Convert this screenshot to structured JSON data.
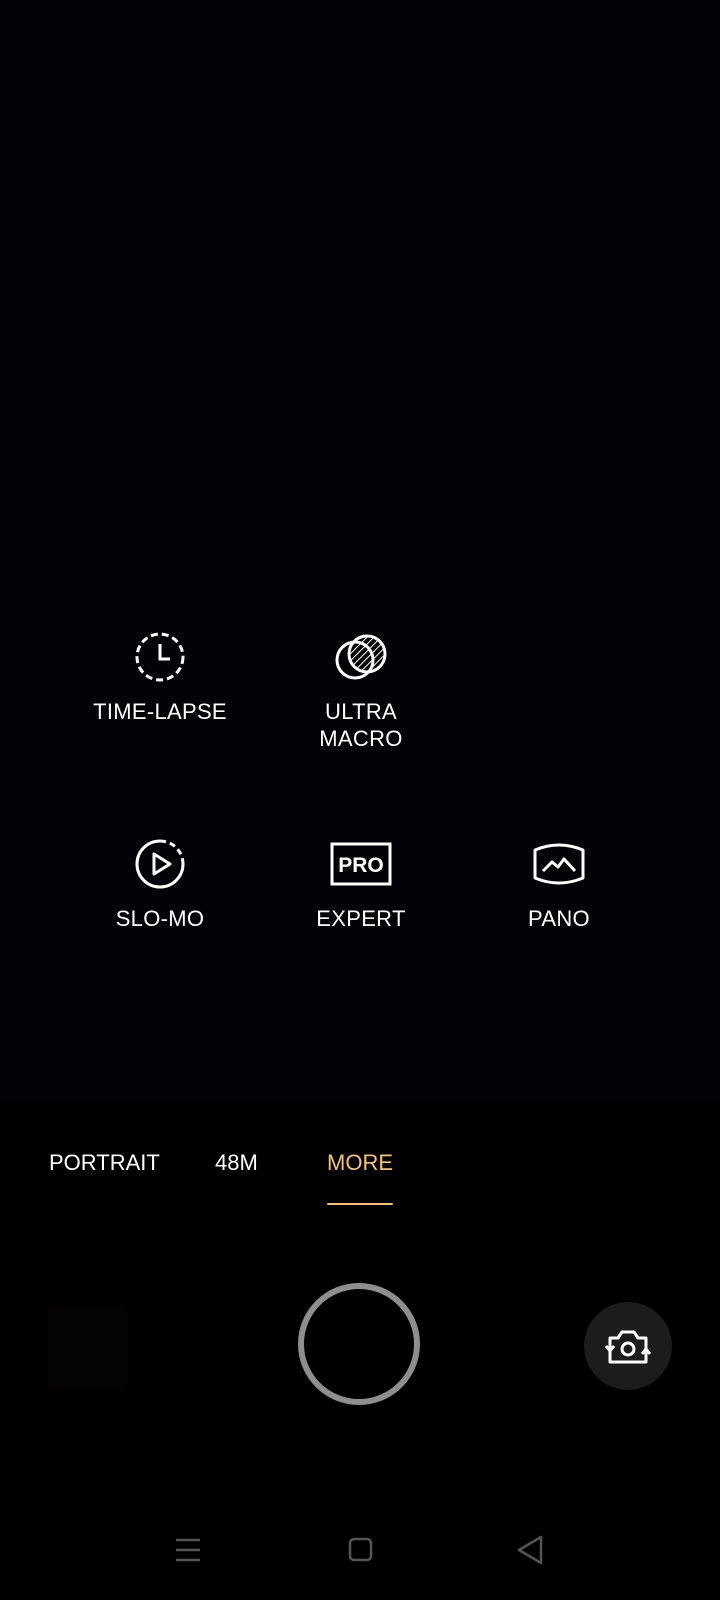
{
  "modes": [
    {
      "label": "TIME-LAPSE",
      "icon": "time-lapse-icon"
    },
    {
      "label": "ULTRA\nMACRO",
      "icon": "ultra-macro-icon"
    },
    {
      "label": "SLO-MO",
      "icon": "slo-mo-icon"
    },
    {
      "label": "EXPERT",
      "icon": "expert-pro-icon",
      "icon_text": "PRO"
    },
    {
      "label": "PANO",
      "icon": "pano-icon"
    }
  ],
  "tabs": [
    {
      "label": "PORTRAIT",
      "active": false
    },
    {
      "label": "48M",
      "active": false
    },
    {
      "label": "MORE",
      "active": true
    }
  ],
  "colors": {
    "accent": "#f2c27d",
    "shutter_ring": "#8e8e8e",
    "background": "#000000"
  },
  "controls": {
    "gallery_icon": "gallery-thumbnail",
    "shutter_icon": "shutter-circle",
    "switch_icon": "switch-camera-icon"
  },
  "navbar": {
    "icons": [
      "menu-icon",
      "home-square-icon",
      "back-triangle-icon"
    ]
  }
}
